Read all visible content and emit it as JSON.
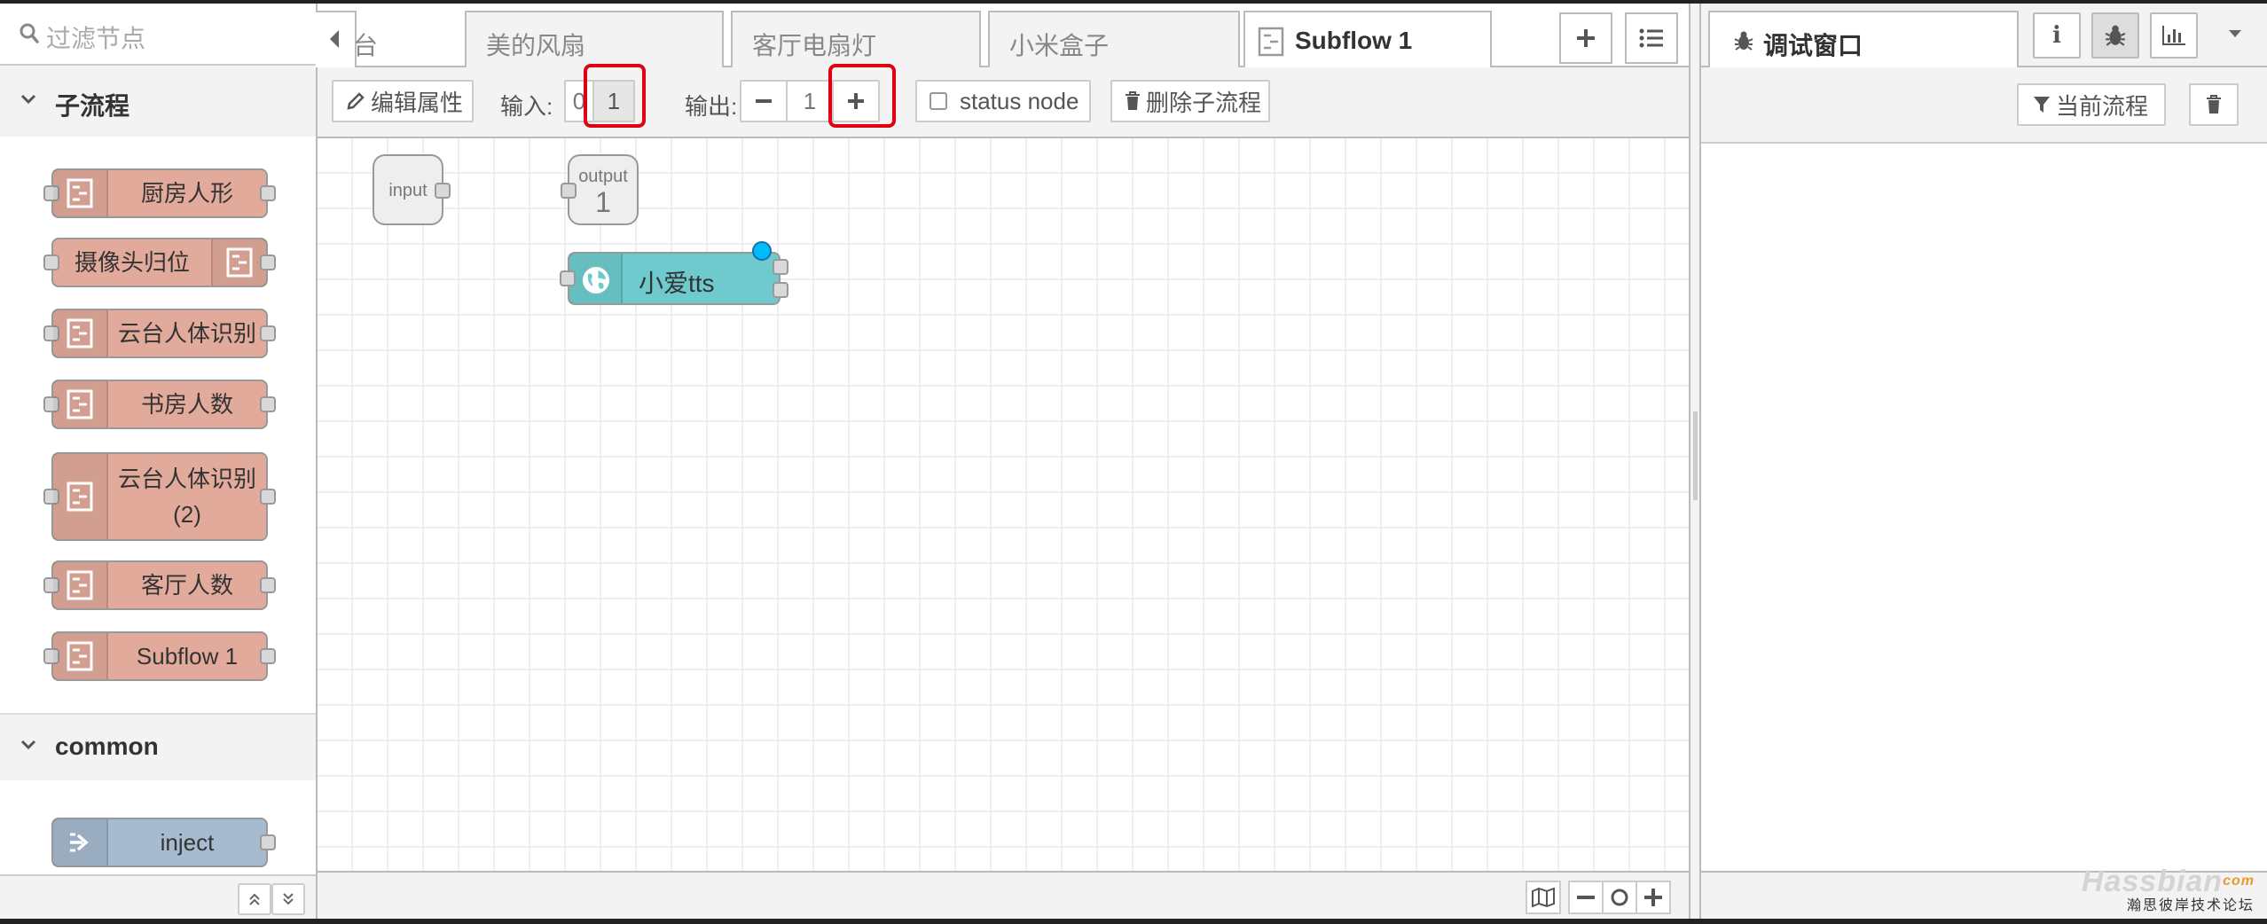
{
  "palette": {
    "filter_placeholder": "过滤节点",
    "categories": [
      {
        "name": "子流程",
        "nodes": [
          {
            "label": "厨房人形",
            "icon_side": "left"
          },
          {
            "label": "摄像头归位",
            "icon_side": "right"
          },
          {
            "label": "云台人体识别",
            "icon_side": "left"
          },
          {
            "label": "书房人数",
            "icon_side": "left"
          },
          {
            "label": "云台人体识别",
            "label_line2": "(2)",
            "icon_side": "left"
          },
          {
            "label": "客厅人数",
            "icon_side": "left"
          },
          {
            "label": "Subflow 1",
            "icon_side": "left"
          }
        ]
      },
      {
        "name": "common",
        "nodes": [
          {
            "label": "inject",
            "icon_side": "left",
            "color": "#a6bbcf"
          }
        ]
      }
    ]
  },
  "tabs": [
    {
      "label": "台",
      "active": false
    },
    {
      "label": "美的风扇",
      "active": false
    },
    {
      "label": "客厅电扇灯",
      "active": false
    },
    {
      "label": "小米盒子",
      "active": false
    },
    {
      "label": "Subflow 1",
      "active": true
    }
  ],
  "subflow_toolbar": {
    "edit_properties": "编辑属性",
    "input_label": "输入:",
    "input_options": [
      "0",
      "1"
    ],
    "input_selected": "1",
    "output_label": "输出:",
    "output_count": "1",
    "status_node_label": "status node",
    "status_node_checked": false,
    "delete_subflow": "删除子流程"
  },
  "canvas": {
    "input_port_label": "input",
    "output_port_label": "output",
    "output_port_number": "1",
    "nodes": [
      {
        "label": "小爱tts",
        "color": "#6ecacd",
        "changed": true,
        "outputs": 2
      }
    ]
  },
  "sidebar": {
    "tab_label": "调试窗口",
    "icons": [
      "info-icon",
      "bug-icon",
      "chart-icon",
      "dropdown-caret-icon"
    ],
    "filter_button": "当前流程",
    "clear_icon": "trash-icon"
  },
  "watermark": {
    "brand": "Hassbian",
    "suffix": "com",
    "subtitle": "瀚思彼岸技术论坛"
  },
  "colors": {
    "subflow_node": "#e2aa9b",
    "inject_node": "#a6bbcf",
    "highlight_red": "#e00012",
    "changed_dot": "#00bcff"
  }
}
